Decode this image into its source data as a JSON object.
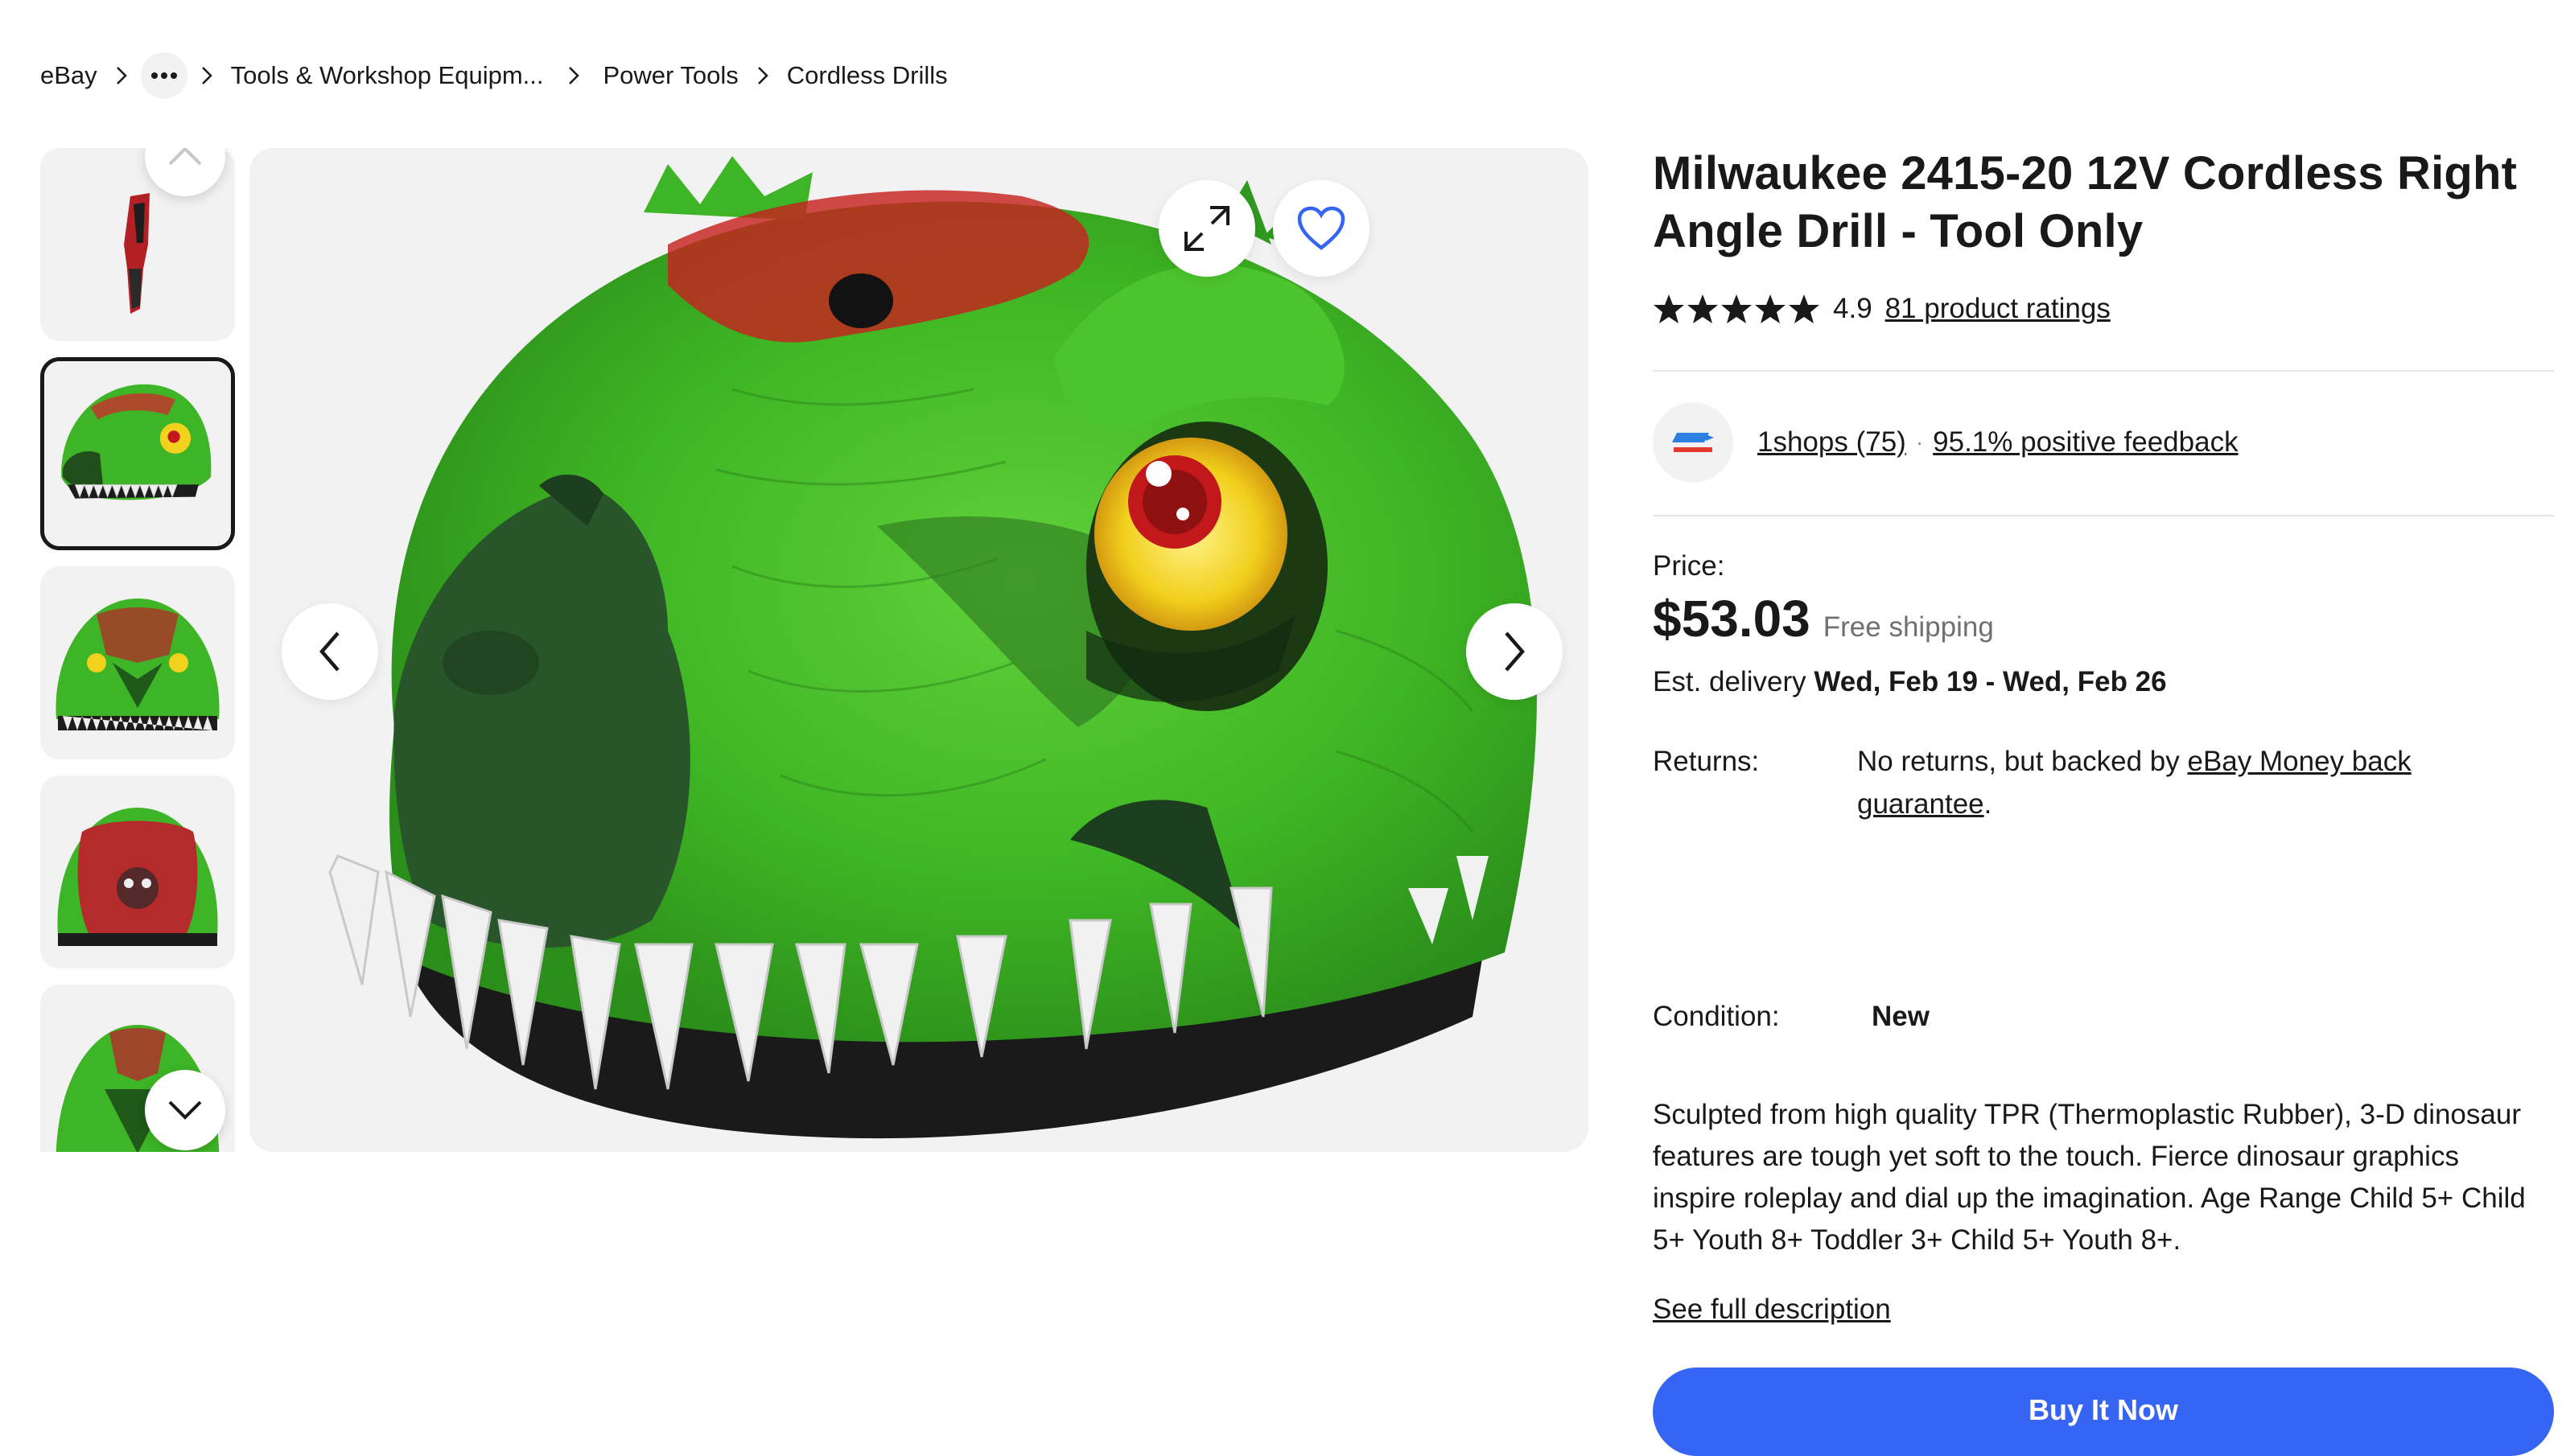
{
  "breadcrumb": {
    "items": [
      "eBay",
      "Tools & Workshop Equipm...",
      "Power Tools",
      "Cordless Drills"
    ],
    "more_icon": "more-horizontal-icon",
    "separator_icon": "chevron-right-icon"
  },
  "gallery": {
    "selected_index": 1,
    "thumbnail_count_visible": 5,
    "prev_icon": "chevron-up-icon",
    "next_icon": "chevron-down-icon",
    "main_prev_icon": "chevron-left-icon",
    "main_next_icon": "chevron-right-icon",
    "expand_icon": "expand-icon",
    "watch_icon": "heart-icon"
  },
  "product": {
    "title": "Milwaukee 2415-20 12V Cordless Right Angle Drill - Tool Only",
    "rating_score": "4.9",
    "rating_stars": 5,
    "ratings_link": "81 product ratings"
  },
  "seller": {
    "name": "1shops (75)",
    "separator": "·",
    "feedback": "95.1% positive feedback"
  },
  "pricing": {
    "price_label": "Price:",
    "price": "$53.03",
    "shipping": "Free shipping",
    "delivery_label": "Est. delivery",
    "delivery_dates": "Wed, Feb 19 - Wed, Feb 26"
  },
  "returns": {
    "label": "Returns:",
    "text_prefix": "No returns, but backed by ",
    "link": "eBay Money back guarantee",
    "text_suffix": "."
  },
  "condition": {
    "label": "Condition:",
    "value": "New"
  },
  "description": {
    "text": "Sculpted from high quality TPR (Thermoplastic Rubber), 3-D dinosaur features are tough yet soft to the touch. Fierce dinosaur graphics inspire roleplay and dial up the imagination. Age Range Child 5+ Child 5+ Youth 8+ Toddler 3+ Child 5+ Youth 8+.",
    "see_full": "See full description"
  },
  "actions": {
    "buy_now": "Buy It Now"
  },
  "colors": {
    "primary_blue": "#3665f3",
    "text": "#191919",
    "muted": "#707070",
    "panel_bg": "#f2f2f2",
    "helmet_green": "#3fb82a"
  }
}
